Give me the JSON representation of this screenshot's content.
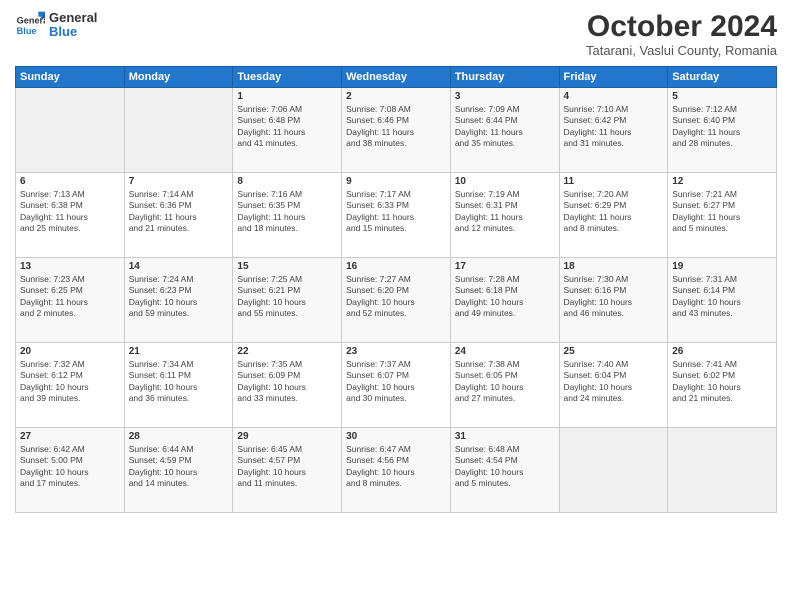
{
  "header": {
    "logo_general": "General",
    "logo_blue": "Blue",
    "month_title": "October 2024",
    "location": "Tatarani, Vaslui County, Romania"
  },
  "weekdays": [
    "Sunday",
    "Monday",
    "Tuesday",
    "Wednesday",
    "Thursday",
    "Friday",
    "Saturday"
  ],
  "weeks": [
    [
      {
        "day": "",
        "info": ""
      },
      {
        "day": "",
        "info": ""
      },
      {
        "day": "1",
        "info": "Sunrise: 7:06 AM\nSunset: 6:48 PM\nDaylight: 11 hours\nand 41 minutes."
      },
      {
        "day": "2",
        "info": "Sunrise: 7:08 AM\nSunset: 6:46 PM\nDaylight: 11 hours\nand 38 minutes."
      },
      {
        "day": "3",
        "info": "Sunrise: 7:09 AM\nSunset: 6:44 PM\nDaylight: 11 hours\nand 35 minutes."
      },
      {
        "day": "4",
        "info": "Sunrise: 7:10 AM\nSunset: 6:42 PM\nDaylight: 11 hours\nand 31 minutes."
      },
      {
        "day": "5",
        "info": "Sunrise: 7:12 AM\nSunset: 6:40 PM\nDaylight: 11 hours\nand 28 minutes."
      }
    ],
    [
      {
        "day": "6",
        "info": "Sunrise: 7:13 AM\nSunset: 6:38 PM\nDaylight: 11 hours\nand 25 minutes."
      },
      {
        "day": "7",
        "info": "Sunrise: 7:14 AM\nSunset: 6:36 PM\nDaylight: 11 hours\nand 21 minutes."
      },
      {
        "day": "8",
        "info": "Sunrise: 7:16 AM\nSunset: 6:35 PM\nDaylight: 11 hours\nand 18 minutes."
      },
      {
        "day": "9",
        "info": "Sunrise: 7:17 AM\nSunset: 6:33 PM\nDaylight: 11 hours\nand 15 minutes."
      },
      {
        "day": "10",
        "info": "Sunrise: 7:19 AM\nSunset: 6:31 PM\nDaylight: 11 hours\nand 12 minutes."
      },
      {
        "day": "11",
        "info": "Sunrise: 7:20 AM\nSunset: 6:29 PM\nDaylight: 11 hours\nand 8 minutes."
      },
      {
        "day": "12",
        "info": "Sunrise: 7:21 AM\nSunset: 6:27 PM\nDaylight: 11 hours\nand 5 minutes."
      }
    ],
    [
      {
        "day": "13",
        "info": "Sunrise: 7:23 AM\nSunset: 6:25 PM\nDaylight: 11 hours\nand 2 minutes."
      },
      {
        "day": "14",
        "info": "Sunrise: 7:24 AM\nSunset: 6:23 PM\nDaylight: 10 hours\nand 59 minutes."
      },
      {
        "day": "15",
        "info": "Sunrise: 7:25 AM\nSunset: 6:21 PM\nDaylight: 10 hours\nand 55 minutes."
      },
      {
        "day": "16",
        "info": "Sunrise: 7:27 AM\nSunset: 6:20 PM\nDaylight: 10 hours\nand 52 minutes."
      },
      {
        "day": "17",
        "info": "Sunrise: 7:28 AM\nSunset: 6:18 PM\nDaylight: 10 hours\nand 49 minutes."
      },
      {
        "day": "18",
        "info": "Sunrise: 7:30 AM\nSunset: 6:16 PM\nDaylight: 10 hours\nand 46 minutes."
      },
      {
        "day": "19",
        "info": "Sunrise: 7:31 AM\nSunset: 6:14 PM\nDaylight: 10 hours\nand 43 minutes."
      }
    ],
    [
      {
        "day": "20",
        "info": "Sunrise: 7:32 AM\nSunset: 6:12 PM\nDaylight: 10 hours\nand 39 minutes."
      },
      {
        "day": "21",
        "info": "Sunrise: 7:34 AM\nSunset: 6:11 PM\nDaylight: 10 hours\nand 36 minutes."
      },
      {
        "day": "22",
        "info": "Sunrise: 7:35 AM\nSunset: 6:09 PM\nDaylight: 10 hours\nand 33 minutes."
      },
      {
        "day": "23",
        "info": "Sunrise: 7:37 AM\nSunset: 6:07 PM\nDaylight: 10 hours\nand 30 minutes."
      },
      {
        "day": "24",
        "info": "Sunrise: 7:38 AM\nSunset: 6:05 PM\nDaylight: 10 hours\nand 27 minutes."
      },
      {
        "day": "25",
        "info": "Sunrise: 7:40 AM\nSunset: 6:04 PM\nDaylight: 10 hours\nand 24 minutes."
      },
      {
        "day": "26",
        "info": "Sunrise: 7:41 AM\nSunset: 6:02 PM\nDaylight: 10 hours\nand 21 minutes."
      }
    ],
    [
      {
        "day": "27",
        "info": "Sunrise: 6:42 AM\nSunset: 5:00 PM\nDaylight: 10 hours\nand 17 minutes."
      },
      {
        "day": "28",
        "info": "Sunrise: 6:44 AM\nSunset: 4:59 PM\nDaylight: 10 hours\nand 14 minutes."
      },
      {
        "day": "29",
        "info": "Sunrise: 6:45 AM\nSunset: 4:57 PM\nDaylight: 10 hours\nand 11 minutes."
      },
      {
        "day": "30",
        "info": "Sunrise: 6:47 AM\nSunset: 4:56 PM\nDaylight: 10 hours\nand 8 minutes."
      },
      {
        "day": "31",
        "info": "Sunrise: 6:48 AM\nSunset: 4:54 PM\nDaylight: 10 hours\nand 5 minutes."
      },
      {
        "day": "",
        "info": ""
      },
      {
        "day": "",
        "info": ""
      }
    ]
  ]
}
